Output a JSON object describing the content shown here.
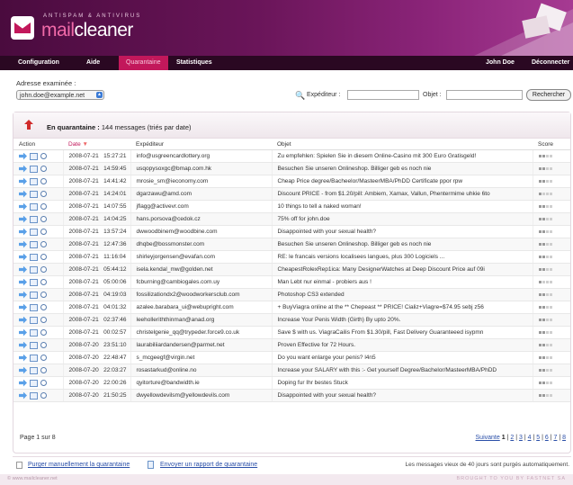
{
  "brand": {
    "tagline": "ANTISPAM & ANTIVIRUS",
    "name_prefix": "mail",
    "name_suffix": "cleaner"
  },
  "menu": {
    "items": [
      {
        "label": "Configuration",
        "active": false
      },
      {
        "label": "Aide",
        "active": false
      },
      {
        "label": "Quarantaine",
        "active": true
      },
      {
        "label": "Statistiques",
        "active": false
      }
    ],
    "user": "John Doe",
    "logout": "Déconnecter"
  },
  "filters": {
    "address_label": "Adresse examinée :",
    "address_value": "john.doe@example.net",
    "sender_label": "Expéditeur :",
    "sender_value": "",
    "subject_label": "Objet :",
    "subject_value": "",
    "search_button": "Rechercher"
  },
  "quarantine": {
    "title": "En quarantaine :",
    "summary": "144 messages (triés par date)"
  },
  "table": {
    "headers": {
      "action": "Action",
      "date": "Date",
      "sender": "Expéditeur",
      "subject": "Objet",
      "score": "Score"
    },
    "rows": [
      {
        "date": "2008-07-21",
        "time": "15:27:21",
        "sender": "info@usgreencardlottery.org",
        "subject": "Zu empfehlen: Spielen Sie in diesem Online-Casino mit 300 Euro Gratisgeld!",
        "score": 2
      },
      {
        "date": "2008-07-21",
        "time": "14:59:45",
        "sender": "usqopysoxgc@bmap.com.hk",
        "subject": "Besuchen Sie unseren Onlineshop. Billiger geb es noch nie",
        "score": 2
      },
      {
        "date": "2008-07-21",
        "time": "14:41:42",
        "sender": "mrosie_sm@ieconomy.com",
        "subject": "Cheap Price degree/Bacheelor/MasteerMBA/PhDD Certificate ppor rpw",
        "score": 2
      },
      {
        "date": "2008-07-21",
        "time": "14:24:01",
        "sender": "dgarzawu@amd.com",
        "subject": "Discount PRICE - from $1.20/pill: Ambiem, Xamax, Vallun, Phentermime uhkie 6to",
        "score": 1
      },
      {
        "date": "2008-07-21",
        "time": "14:07:55",
        "sender": "jflagg@activevr.com",
        "subject": "10 things to tell a naked woman!",
        "score": 2
      },
      {
        "date": "2008-07-21",
        "time": "14:04:25",
        "sender": "hans.porsova@cedok.cz",
        "subject": "75% off for john.doe",
        "score": 2
      },
      {
        "date": "2008-07-21",
        "time": "13:57:24",
        "sender": "dwwoodbinem@woodbine.com",
        "subject": "Disappointed with your sexual health?",
        "score": 2
      },
      {
        "date": "2008-07-21",
        "time": "12:47:36",
        "sender": "dhqbe@bossmonster.com",
        "subject": "Besuchen Sie unseren Onlineshop. Billiger geb es noch nie",
        "score": 2
      },
      {
        "date": "2008-07-21",
        "time": "11:16:04",
        "sender": "shirleyjorgensen@evafan.com",
        "subject": "RE: le francais versions localisees langues, plus 300 Logiciels ...",
        "score": 2
      },
      {
        "date": "2008-07-21",
        "time": "05:44:12",
        "sender": "isela.kendal_mw@golden.net",
        "subject": "CheapestRolexRep1ica: Many DesignerWatches at Deep Discount Price auf 09i",
        "score": 2
      },
      {
        "date": "2008-07-21",
        "time": "05:00:06",
        "sender": "fcburning@cambiogales.com.uy",
        "subject": "Man Lebt nur einmal - probiers aus !",
        "score": 1
      },
      {
        "date": "2008-07-21",
        "time": "04:19:03",
        "sender": "fossilizationdx2@woodworkersclub.com",
        "subject": "Photoshop CS3 extended",
        "score": 2
      },
      {
        "date": "2008-07-21",
        "time": "04:01:32",
        "sender": "azalee.barabara_ui@webupright.com",
        "subject": "+ BuyViagra online at the ** Chepeast ** PRICE! Cializ+Viagre=$74.95 sebj z56",
        "score": 2
      },
      {
        "date": "2008-07-21",
        "time": "02:37:46",
        "sender": "leeholleriththinman@anad.org",
        "subject": "Increase Your Penis Width (Girth) By upto 20%.",
        "score": 2
      },
      {
        "date": "2008-07-21",
        "time": "00:02:57",
        "sender": "christelgenie_qq@trypeder.force9.co.uk",
        "subject": "Save $ with us. ViagraCailis From $1.30/pill, Fast Delivery Guaranteeed isypmn",
        "score": 2
      },
      {
        "date": "2008-07-20",
        "time": "23:51:10",
        "sender": "laurabiliiardandersen@parmet.net",
        "subject": "Proven Effective for 72 Hours.",
        "score": 2
      },
      {
        "date": "2008-07-20",
        "time": "22:48:47",
        "sender": "s_mcgeegf@virgin.net",
        "subject": "Do you want enlarge your penis? l4n5",
        "score": 2
      },
      {
        "date": "2008-07-20",
        "time": "22:03:27",
        "sender": "rosastarkud@online.no",
        "subject": "Increase your SALARY with this :- Get yourself Degree/Bachelor/MasteerMBA/PhDD",
        "score": 2
      },
      {
        "date": "2008-07-20",
        "time": "22:00:26",
        "sender": "qyitorture@bandwidth.ie",
        "subject": "Doping fur Ihr bestes Stuck",
        "score": 2
      },
      {
        "date": "2008-07-20",
        "time": "21:50:25",
        "sender": "dwyellowdevilsm@yellowdevils.com",
        "subject": "Disappointed with your sexual health?",
        "score": 2
      }
    ]
  },
  "pager": {
    "page_info": "Page 1 sur 8",
    "next": "Suivante",
    "current": "1",
    "pages": [
      "2",
      "3",
      "4",
      "5",
      "6",
      "7",
      "8"
    ]
  },
  "footer": {
    "purge": "Purger manuellement la quarantaine",
    "report": "Envoyer un rapport de quarantaine",
    "note": "Les messages vieux de 40 jours sont purgés automatiquement."
  },
  "bottom": {
    "left": "© www.mailcleaner.net",
    "right": "BROUGHT TO YOU BY FASTNET SA"
  },
  "colors": {
    "header": "#6a1559",
    "menubar": "#2a0822",
    "active_tab": "#c2185b",
    "link": "#2a4fa8"
  }
}
